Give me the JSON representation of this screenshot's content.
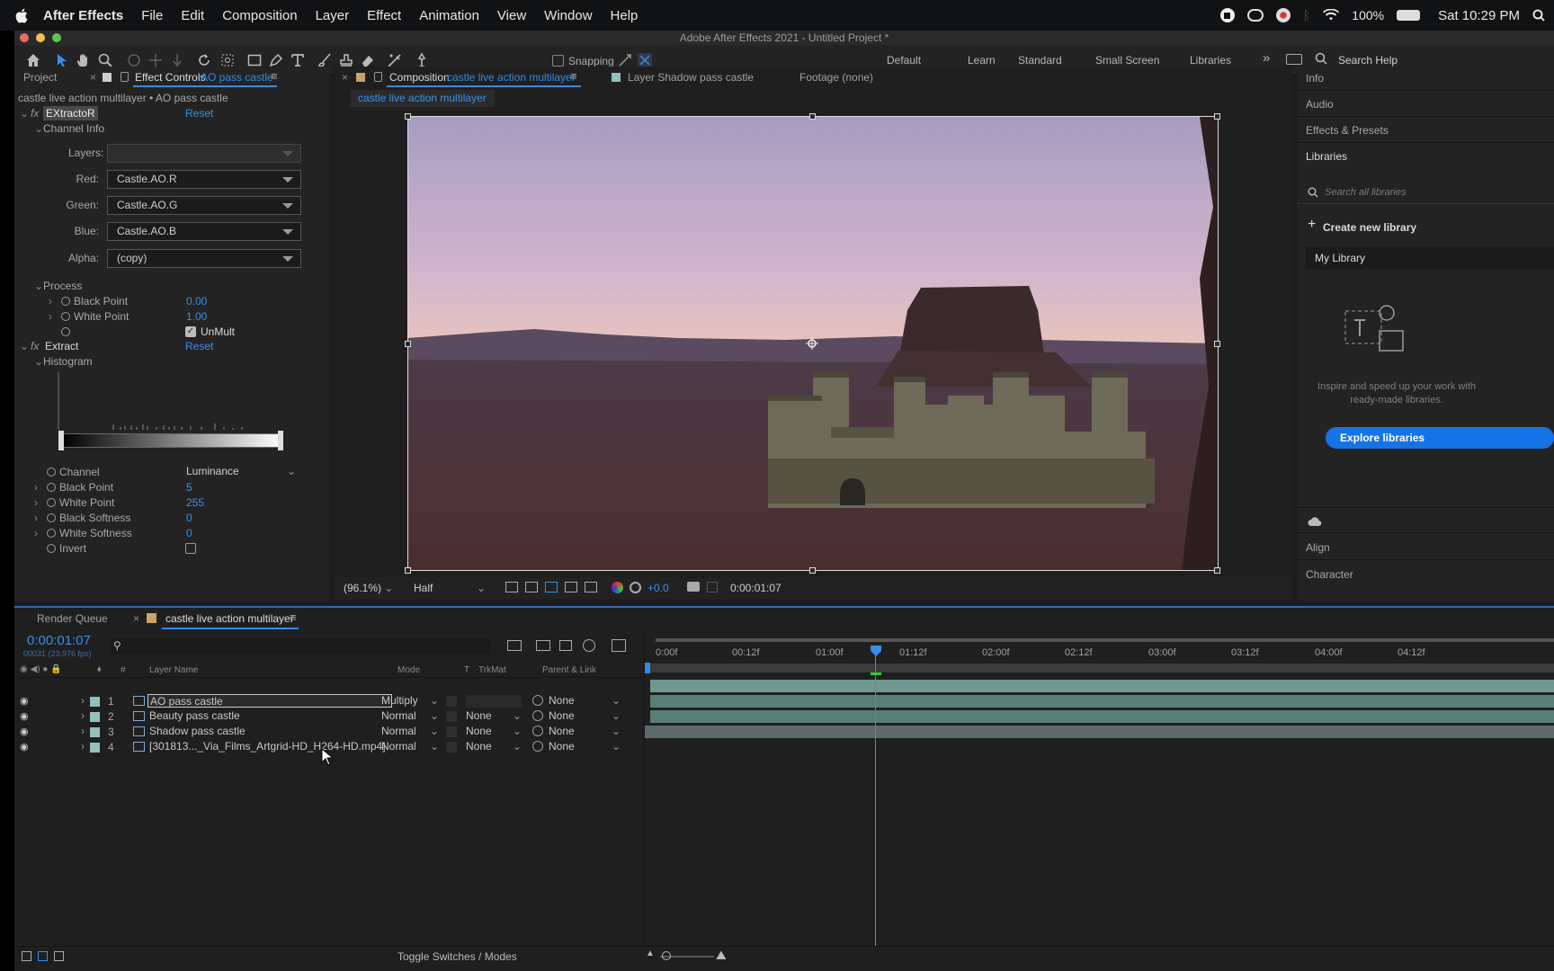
{
  "menubar": {
    "app": "After Effects",
    "items": [
      "File",
      "Edit",
      "Composition",
      "Layer",
      "Effect",
      "Animation",
      "View",
      "Window",
      "Help"
    ],
    "battery": "100%",
    "clock": "Sat 10:29 PM"
  },
  "window_title": "Adobe After Effects 2021 - Untitled Project *",
  "toolbar": {
    "snapping": "Snapping",
    "workspaces": [
      "Default",
      "Learn",
      "Standard",
      "Small Screen",
      "Libraries"
    ],
    "search_help": "Search Help"
  },
  "left_panel": {
    "tab_project": "Project",
    "tab_effect_controls": "Effect Controls",
    "tab_effect_controls_layer": "AO pass castle",
    "breadcrumb": "castle live action multilayer • AO pass castle",
    "extractor": {
      "name": "EXtractoR",
      "reset": "Reset",
      "group_channel_info": "Channel Info",
      "layers_label": "Layers:",
      "layers_value": "",
      "red_label": "Red:",
      "red_value": "Castle.AO.R",
      "green_label": "Green:",
      "green_value": "Castle.AO.G",
      "blue_label": "Blue:",
      "blue_value": "Castle.AO.B",
      "alpha_label": "Alpha:",
      "alpha_value": "(copy)",
      "group_process": "Process",
      "black_point_label": "Black Point",
      "black_point_value": "0.00",
      "white_point_label": "White Point",
      "white_point_value": "1.00",
      "unmult_label": "UnMult"
    },
    "extract": {
      "name": "Extract",
      "reset": "Reset",
      "group_histogram": "Histogram",
      "channel_label": "Channel",
      "channel_value": "Luminance",
      "black_point_label": "Black Point",
      "black_point_value": "5",
      "white_point_label": "White Point",
      "white_point_value": "255",
      "black_softness_label": "Black Softness",
      "black_softness_value": "0",
      "white_softness_label": "White Softness",
      "white_softness_value": "0",
      "invert_label": "Invert"
    }
  },
  "viewer": {
    "tab_composition": "Composition",
    "tab_composition_name": "castle live action multilayer",
    "tab_layer": "Layer Shadow pass castle",
    "tab_footage": "Footage (none)",
    "comp_chip": "castle live action multilayer",
    "zoom": "(96.1%)",
    "resolution": "Half",
    "exposure": "+0.0",
    "timecode": "0:00:01:07"
  },
  "right_panel": {
    "items": [
      "Info",
      "Audio",
      "Effects & Presets",
      "Libraries"
    ],
    "search_placeholder": "Search all libraries",
    "create_library": "Create new library",
    "my_library": "My Library",
    "inspire_text": "Inspire and speed up your work with ready-made libraries.",
    "explore": "Explore libraries",
    "bottom_items": [
      "Align",
      "Character"
    ]
  },
  "timeline": {
    "tab_render_queue": "Render Queue",
    "tab_comp": "castle live action multilayer",
    "timecode": "0:00:01:07",
    "fps_info": "00031 (23.976 fps)",
    "col_layer_name": "Layer Name",
    "col_mode": "Mode",
    "col_t": "T",
    "col_trkmat": "TrkMat",
    "col_parent": "Parent & Link",
    "ruler": [
      "0:00f",
      "00:12f",
      "01:00f",
      "01:12f",
      "02:00f",
      "02:12f",
      "03:00f",
      "03:12f",
      "04:00f",
      "04:12f"
    ],
    "playhead_fraction": 0.278,
    "layers": [
      {
        "num": "1",
        "name": "AO pass castle",
        "mode": "Multiply",
        "trkmat": "",
        "parent": "None"
      },
      {
        "num": "2",
        "name": "Beauty pass castle",
        "mode": "Normal",
        "trkmat": "None",
        "parent": "None"
      },
      {
        "num": "3",
        "name": "Shadow pass castle",
        "mode": "Normal",
        "trkmat": "None",
        "parent": "None"
      },
      {
        "num": "4",
        "name": "[301813..._Via_Films_Artgrid-HD_H264-HD.mp4]",
        "mode": "Normal",
        "trkmat": "None",
        "parent": "None"
      }
    ],
    "toggle_label": "Toggle Switches / Modes"
  }
}
